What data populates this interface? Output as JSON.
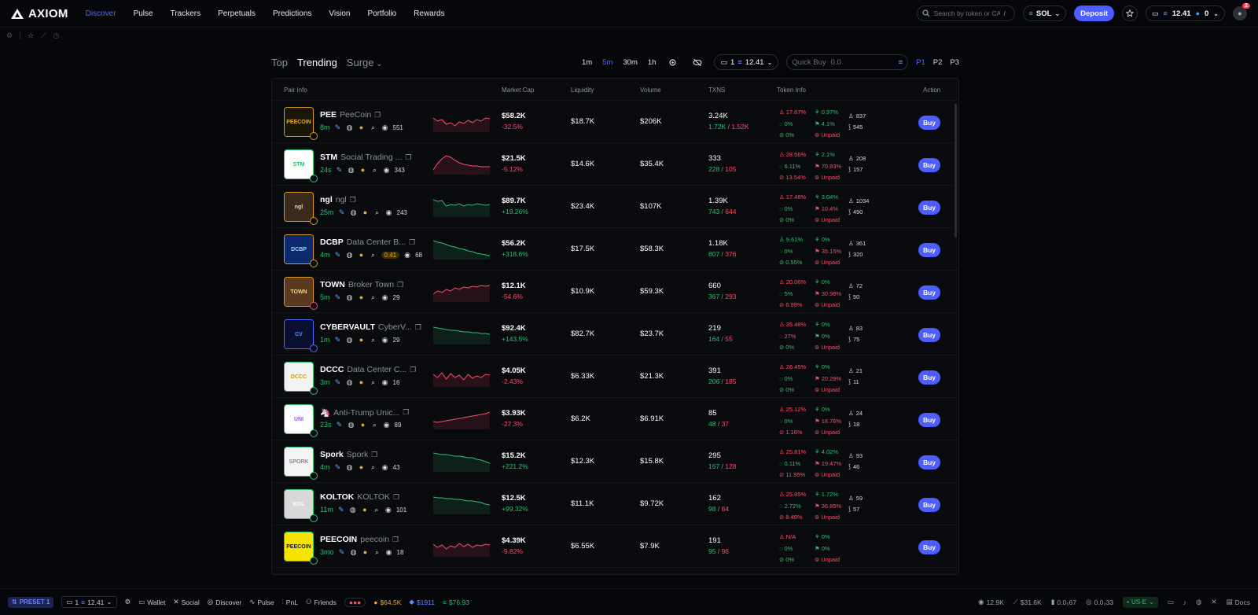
{
  "app": {
    "name": "AXIOM"
  },
  "nav": [
    {
      "label": "Discover",
      "active": true
    },
    {
      "label": "Pulse"
    },
    {
      "label": "Trackers"
    },
    {
      "label": "Perpetuals"
    },
    {
      "label": "Predictions"
    },
    {
      "label": "Vision"
    },
    {
      "label": "Portfolio"
    },
    {
      "label": "Rewards"
    }
  ],
  "header": {
    "search_placeholder": "Search by token or CA",
    "search_shortcut": "/",
    "chain": "SOL",
    "deposit_label": "Deposit",
    "balance": "12.41",
    "points": "0",
    "notif_count": "2"
  },
  "tabs": [
    {
      "label": "Top"
    },
    {
      "label": "Trending",
      "active": true
    },
    {
      "label": "Surge"
    }
  ],
  "timeframes": [
    {
      "label": "1m"
    },
    {
      "label": "5m",
      "active": true
    },
    {
      "label": "30m"
    },
    {
      "label": "1h"
    }
  ],
  "wallet_selector": {
    "count": "1",
    "balance": "12.41"
  },
  "quick_buy": {
    "label": "Quick Buy",
    "placeholder": "0.0"
  },
  "presets": [
    {
      "label": "P1",
      "active": true
    },
    {
      "label": "P2"
    },
    {
      "label": "P3"
    }
  ],
  "columns": {
    "pair": "Pair Info",
    "mcap": "Market Cap",
    "liq": "Liquidity",
    "vol": "Volume",
    "txns": "TXNS",
    "info": "Token Info",
    "action": "Action"
  },
  "buy_label": "Buy",
  "rows": [
    {
      "symbol": "PEE",
      "name": "PeeCoin",
      "age": "8m",
      "views": "551",
      "mcap": "$58.2K",
      "change": "-32.5%",
      "liq": "$18.7K",
      "vol": "$206K",
      "txns": "3.24K",
      "buys": "1.72K",
      "sells": "1.52K",
      "info": [
        "17.67%",
        "0.97%",
        "0%",
        "4.1%",
        "0%",
        "Unpaid"
      ],
      "holders": "837",
      "pro": "545",
      "thumb_text": "PEECOIN",
      "thumb_bg": "#1a1608",
      "thumb_fg": "#e3b021",
      "border": "gold",
      "spark": [
        18,
        14,
        16,
        10,
        12,
        8,
        13,
        11,
        15,
        12,
        16,
        14,
        18,
        17
      ]
    },
    {
      "symbol": "STM",
      "name": "Social Trading ...",
      "age": "24s",
      "views": "343",
      "mcap": "$21.5K",
      "change": "-5.12%",
      "liq": "$14.6K",
      "vol": "$35.4K",
      "txns": "333",
      "buys": "228",
      "sells": "105",
      "info": [
        "28.56%",
        "2.1%",
        "6.11%",
        "70.93%",
        "13.54%",
        "Unpaid"
      ],
      "holders": "208",
      "pro": "157",
      "thumb_text": "STM",
      "thumb_bg": "#ffffff",
      "thumb_fg": "#27c36a",
      "border": "green",
      "spark": [
        6,
        14,
        20,
        24,
        22,
        18,
        15,
        13,
        12,
        11,
        11,
        10,
        10,
        10
      ]
    },
    {
      "symbol": "ngl",
      "name": "ngl",
      "age": "25m",
      "views": "243",
      "mcap": "$89.7K",
      "change": "+19.26%",
      "liq": "$23.4K",
      "vol": "$107K",
      "txns": "1.39K",
      "buys": "743",
      "sells": "644",
      "info": [
        "17.48%",
        "3.04%",
        "0%",
        "10.4%",
        "0%",
        "Unpaid"
      ],
      "holders": "1034",
      "pro": "490",
      "thumb_text": "ngl",
      "thumb_bg": "#3b2a1c",
      "thumb_fg": "#e6d3b8",
      "border": "gold",
      "spark": [
        22,
        20,
        21,
        14,
        16,
        15,
        17,
        14,
        16,
        15,
        17,
        16,
        15,
        16
      ]
    },
    {
      "symbol": "DCBP",
      "name": "Data Center B...",
      "age": "4m",
      "views": "68",
      "timer": "0:41",
      "mcap": "$56.2K",
      "change": "+318.6%",
      "liq": "$17.5K",
      "vol": "$58.3K",
      "txns": "1.18K",
      "buys": "807",
      "sells": "376",
      "info": [
        "9.61%",
        "0%",
        "0%",
        "35.15%",
        "0.55%",
        "Unpaid"
      ],
      "holders": "361",
      "pro": "320",
      "thumb_text": "DCBP",
      "thumb_bg": "#0b2a6e",
      "thumb_fg": "#9fd3ff",
      "border": "gold",
      "spark": [
        24,
        22,
        21,
        19,
        17,
        16,
        14,
        13,
        11,
        10,
        8,
        7,
        6,
        5
      ]
    },
    {
      "symbol": "TOWN",
      "name": "Broker Town",
      "age": "5m",
      "views": "29",
      "mcap": "$12.1K",
      "change": "-54.6%",
      "liq": "$10.9K",
      "vol": "$59.3K",
      "txns": "660",
      "buys": "367",
      "sells": "293",
      "info": [
        "20.06%",
        "0%",
        "5%",
        "30.98%",
        "6.99%",
        "Unpaid"
      ],
      "holders": "72",
      "pro": "50",
      "thumb_text": "TOWN",
      "thumb_bg": "#5a3a1e",
      "thumb_fg": "#f2d28a",
      "border": "red",
      "spark": [
        10,
        14,
        12,
        16,
        14,
        18,
        16,
        19,
        18,
        20,
        19,
        21,
        20,
        21
      ]
    },
    {
      "symbol": "CYBERVAULT",
      "name": "CyberV...",
      "age": "1m",
      "views": "29",
      "mcap": "$92.4K",
      "change": "+143.5%",
      "liq": "$82.7K",
      "vol": "$23.7K",
      "txns": "219",
      "buys": "164",
      "sells": "55",
      "info": [
        "35.48%",
        "0%",
        "27%",
        "0%",
        "0%",
        "Unpaid"
      ],
      "holders": "83",
      "pro": "75",
      "thumb_text": "CV",
      "thumb_bg": "#0b1030",
      "thumb_fg": "#5f8bff",
      "border": "blue",
      "spark": [
        22,
        21,
        20,
        19,
        18,
        18,
        17,
        16,
        16,
        15,
        15,
        14,
        14,
        13
      ]
    },
    {
      "symbol": "DCCC",
      "name": "Data Center C...",
      "age": "3m",
      "views": "16",
      "mcap": "$4.05K",
      "change": "-2.43%",
      "liq": "$6.33K",
      "vol": "$21.3K",
      "txns": "391",
      "buys": "206",
      "sells": "185",
      "info": [
        "26.45%",
        "0%",
        "0%",
        "20.29%",
        "0%",
        "Unpaid"
      ],
      "holders": "21",
      "pro": "11",
      "thumb_text": "DCCC",
      "thumb_bg": "#f2f2f2",
      "thumb_fg": "#c9a019",
      "border": "green",
      "spark": [
        16,
        12,
        18,
        10,
        17,
        12,
        15,
        9,
        16,
        11,
        14,
        12,
        16,
        15
      ]
    },
    {
      "symbol": "",
      "name": "Anti-Trump Unic...",
      "age": "23s",
      "views": "89",
      "mcap": "$3.93K",
      "change": "-27.3%",
      "liq": "$6.2K",
      "vol": "$6.91K",
      "txns": "85",
      "buys": "48",
      "sells": "37",
      "info": [
        "25.12%",
        "0%",
        "0%",
        "18.76%",
        "1.16%",
        "Unpaid"
      ],
      "holders": "24",
      "pro": "18",
      "thumb_text": "UNI",
      "thumb_bg": "#ffffff",
      "thumb_fg": "#a64de0",
      "border": "green",
      "spark": [
        10,
        9,
        10,
        11,
        12,
        13,
        14,
        15,
        16,
        17,
        18,
        19,
        20,
        22
      ]
    },
    {
      "symbol": "Spork",
      "name": "Spork",
      "age": "4m",
      "views": "43",
      "mcap": "$15.2K",
      "change": "+221.2%",
      "liq": "$12.3K",
      "vol": "$15.8K",
      "txns": "295",
      "buys": "167",
      "sells": "128",
      "info": [
        "25.81%",
        "4.02%",
        "0.11%",
        "19.47%",
        "11.95%",
        "Unpaid"
      ],
      "holders": "93",
      "pro": "46",
      "thumb_text": "SPORK",
      "thumb_bg": "#f4f4f4",
      "thumb_fg": "#888888",
      "border": "green",
      "spark": [
        24,
        23,
        22,
        22,
        21,
        20,
        20,
        19,
        18,
        18,
        16,
        15,
        13,
        11
      ]
    },
    {
      "symbol": "KOLTOK",
      "name": "KOLTOK",
      "age": "11m",
      "views": "101",
      "mcap": "$12.5K",
      "change": "+99.32%",
      "liq": "$11.1K",
      "vol": "$9.72K",
      "txns": "162",
      "buys": "98",
      "sells": "64",
      "info": [
        "25.85%",
        "1.72%",
        "2.72%",
        "36.85%",
        "8.49%",
        "Unpaid"
      ],
      "holders": "59",
      "pro": "57",
      "thumb_text": "KOL",
      "thumb_bg": "#d8d8d8",
      "thumb_fg": "#ffffff",
      "border": "green",
      "spark": [
        22,
        21,
        21,
        20,
        20,
        19,
        19,
        18,
        17,
        17,
        16,
        15,
        13,
        12
      ]
    },
    {
      "symbol": "PEECOIN",
      "name": "peecoin",
      "age": "3mo",
      "views": "18",
      "mcap": "$4.39K",
      "change": "-9.82%",
      "liq": "$6.55K",
      "vol": "$7.9K",
      "txns": "191",
      "buys": "95",
      "sells": "96",
      "info": [
        "N/A",
        "0%",
        "0%",
        "0%",
        "0%",
        "Unpaid"
      ],
      "holders": "",
      "pro": "",
      "thumb_text": "PEECOIN",
      "thumb_bg": "#f5e400",
      "thumb_fg": "#1a1a1a",
      "border": "green",
      "spark": [
        16,
        12,
        15,
        10,
        14,
        12,
        17,
        13,
        16,
        12,
        15,
        14,
        16,
        15
      ]
    }
  ],
  "footer": {
    "preset": "PRESET 1",
    "wallet_count": "1",
    "wallet_balance": "12.41",
    "links": [
      "Wallet",
      "Social",
      "Discover",
      "Pulse",
      "PnL",
      "Friends"
    ],
    "btc": "$64.5K",
    "eth": "$1911",
    "sol": "$76.93",
    "stat1": "12.9K",
    "stat2": "$31.6K",
    "stat3": "0.0₅67",
    "stat4": "0.0₂33",
    "region": "US-E",
    "docs": "Docs"
  }
}
